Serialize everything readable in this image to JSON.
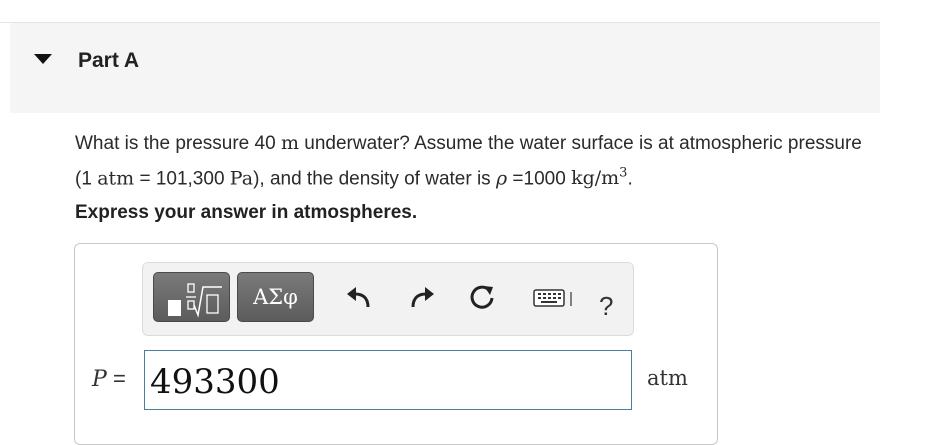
{
  "part": {
    "title": "Part A"
  },
  "question": {
    "s1": "What is the pressure 40 ",
    "u_m": "m",
    "s2": " underwater? Assume the water surface is at atmospheric pressure (1 ",
    "u_atm": "atm",
    "s3": " = 101,300 ",
    "u_pa": "Pa",
    "s4": "), and the density of water is ",
    "rho": "ρ",
    "s5": " =1000 ",
    "u_density": "kg/m",
    "u_density_exp": "3",
    "s6": "."
  },
  "instruction": "Express your answer in atmospheres.",
  "toolbar": {
    "template_icon": "fraction-radical-template-icon",
    "symbols_label": "ΑΣφ",
    "undo_icon": "undo-icon",
    "redo_icon": "redo-icon",
    "reset_icon": "reset-icon",
    "keyboard_icon": "keyboard-icon",
    "help_label": "?"
  },
  "answer": {
    "variable": "P",
    "equals": "=",
    "value": "493300",
    "unit": "atm"
  },
  "colors": {
    "header_bg": "#f5f5f5",
    "input_border": "#4a7fa0",
    "tool_button": "#6a6a6a"
  }
}
